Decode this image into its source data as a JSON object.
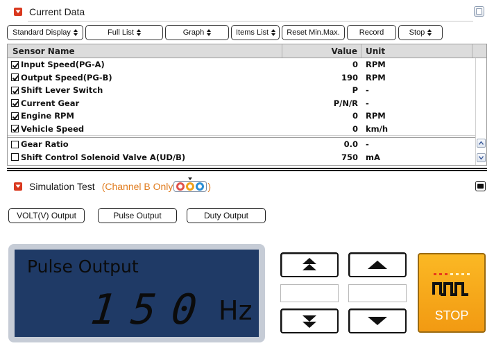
{
  "current_data": {
    "title": "Current Data",
    "toolbar": [
      {
        "label": "Standard Display",
        "dropdown": true,
        "w": 110
      },
      {
        "label": "Full List",
        "dropdown": true,
        "w": 112
      },
      {
        "label": "Graph",
        "dropdown": true,
        "w": 92
      },
      {
        "label": "Items List",
        "dropdown": true,
        "w": 70
      },
      {
        "label": "Reset Min.Max.",
        "dropdown": false,
        "w": 91
      },
      {
        "label": "Record",
        "dropdown": false,
        "w": 71
      },
      {
        "label": "Stop",
        "dropdown": true,
        "w": 64
      }
    ],
    "table": {
      "headers": {
        "name": "Sensor Name",
        "value": "Value",
        "unit": "Unit"
      },
      "rows": [
        {
          "name": "Input Speed(PG-A)",
          "value": "0",
          "unit": "RPM",
          "checked": true
        },
        {
          "name": "Output Speed(PG-B)",
          "value": "190",
          "unit": "RPM",
          "checked": true
        },
        {
          "name": "Shift Lever Switch",
          "value": "P",
          "unit": "-",
          "checked": true
        },
        {
          "name": "Current Gear",
          "value": "P/N/R",
          "unit": "-",
          "checked": true
        },
        {
          "name": "Engine RPM",
          "value": "0",
          "unit": "RPM",
          "checked": true
        },
        {
          "name": "Vehicle Speed",
          "value": "0",
          "unit": "km/h",
          "checked": true
        }
      ],
      "rows_unselected": [
        {
          "name": "Gear Ratio",
          "value": "0.0",
          "unit": "-",
          "checked": false
        },
        {
          "name": "Shift Control Solenoid Valve A(UD/B)",
          "value": "750",
          "unit": "mA",
          "checked": false
        }
      ]
    }
  },
  "simulation": {
    "title": "Simulation Test",
    "subtitle_prefix": "(Channel B Only",
    "subtitle_suffix": ")",
    "channel_colors": [
      "#e0524c",
      "#f0a21a",
      "#2b8fd6"
    ],
    "output_buttons": [
      "VOLT(V) Output",
      "Pulse Output",
      "Duty Output"
    ],
    "display": {
      "title": "Pulse Output",
      "value": "150",
      "unit": "Hz"
    },
    "stop_label": "STOP",
    "colors": {
      "accent_red": "#d9381e",
      "display_bg": "#1f3a66",
      "stop_bg": "#f5a516"
    }
  }
}
